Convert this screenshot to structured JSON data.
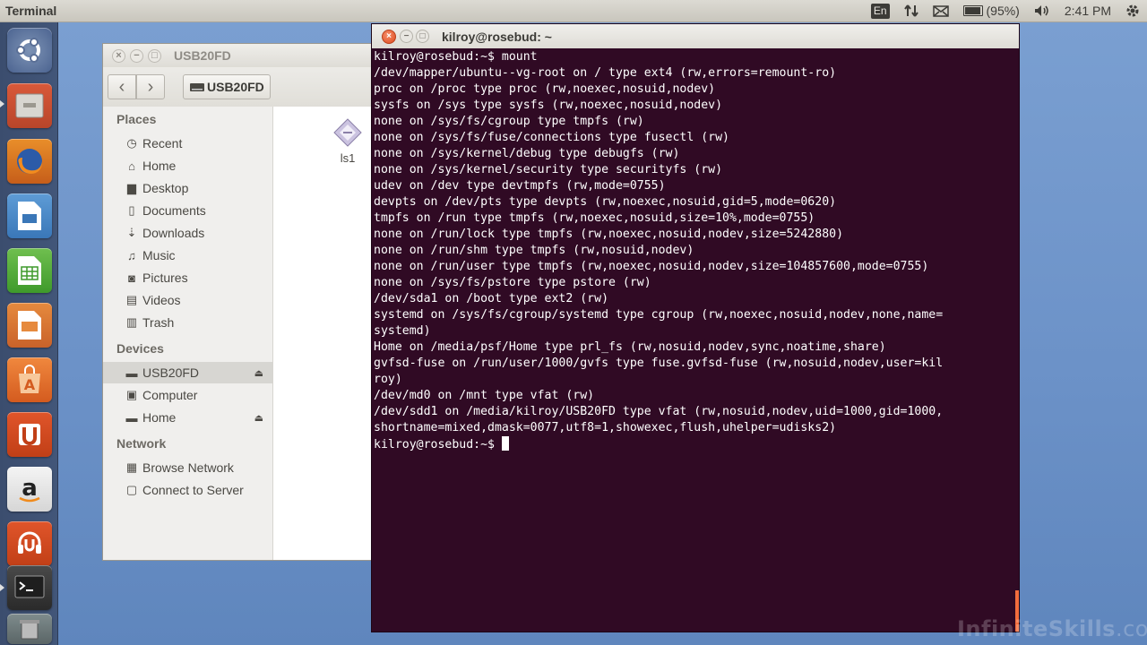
{
  "top_panel": {
    "app_title": "Terminal",
    "keyboard": "En",
    "battery": "(95%)",
    "clock": "2:41 PM"
  },
  "launcher": {
    "items": [
      "Dash Home",
      "Files",
      "Firefox Web Browser",
      "LibreOffice Draw",
      "LibreOffice Calc",
      "LibreOffice Impress",
      "Ubuntu Software Center",
      "Ubuntu One",
      "Amazon",
      "Ubuntu One Music",
      "Terminal"
    ]
  },
  "file_manager": {
    "title": "USB20FD",
    "path_button": "USB20FD",
    "sections": {
      "places": "Places",
      "devices": "Devices",
      "network": "Network"
    },
    "places": [
      "Recent",
      "Home",
      "Desktop",
      "Documents",
      "Downloads",
      "Music",
      "Pictures",
      "Videos",
      "Trash"
    ],
    "devices": [
      "USB20FD",
      "Computer",
      "Home"
    ],
    "network": [
      "Browse Network",
      "Connect to Server"
    ],
    "files": [
      {
        "name": "ls1"
      }
    ]
  },
  "terminal": {
    "title": "kilroy@rosebud: ~",
    "lines": [
      "kilroy@rosebud:~$ mount",
      "/dev/mapper/ubuntu--vg-root on / type ext4 (rw,errors=remount-ro)",
      "proc on /proc type proc (rw,noexec,nosuid,nodev)",
      "sysfs on /sys type sysfs (rw,noexec,nosuid,nodev)",
      "none on /sys/fs/cgroup type tmpfs (rw)",
      "none on /sys/fs/fuse/connections type fusectl (rw)",
      "none on /sys/kernel/debug type debugfs (rw)",
      "none on /sys/kernel/security type securityfs (rw)",
      "udev on /dev type devtmpfs (rw,mode=0755)",
      "devpts on /dev/pts type devpts (rw,noexec,nosuid,gid=5,mode=0620)",
      "tmpfs on /run type tmpfs (rw,noexec,nosuid,size=10%,mode=0755)",
      "none on /run/lock type tmpfs (rw,noexec,nosuid,nodev,size=5242880)",
      "none on /run/shm type tmpfs (rw,nosuid,nodev)",
      "none on /run/user type tmpfs (rw,noexec,nosuid,nodev,size=104857600,mode=0755)",
      "none on /sys/fs/pstore type pstore (rw)",
      "/dev/sda1 on /boot type ext2 (rw)",
      "systemd on /sys/fs/cgroup/systemd type cgroup (rw,noexec,nosuid,nodev,none,name=",
      "systemd)",
      "Home on /media/psf/Home type prl_fs (rw,nosuid,nodev,sync,noatime,share)",
      "gvfsd-fuse on /run/user/1000/gvfs type fuse.gvfsd-fuse (rw,nosuid,nodev,user=kil",
      "roy)",
      "/dev/md0 on /mnt type vfat (rw)",
      "/dev/sdd1 on /media/kilroy/USB20FD type vfat (rw,nosuid,nodev,uid=1000,gid=1000,",
      "shortname=mixed,dmask=0077,utf8=1,showexec,flush,uhelper=udisks2)"
    ],
    "prompt": "kilroy@rosebud:~$ "
  },
  "watermark": {
    "brand": "InfiniteSkills",
    "suffix": ".com"
  }
}
